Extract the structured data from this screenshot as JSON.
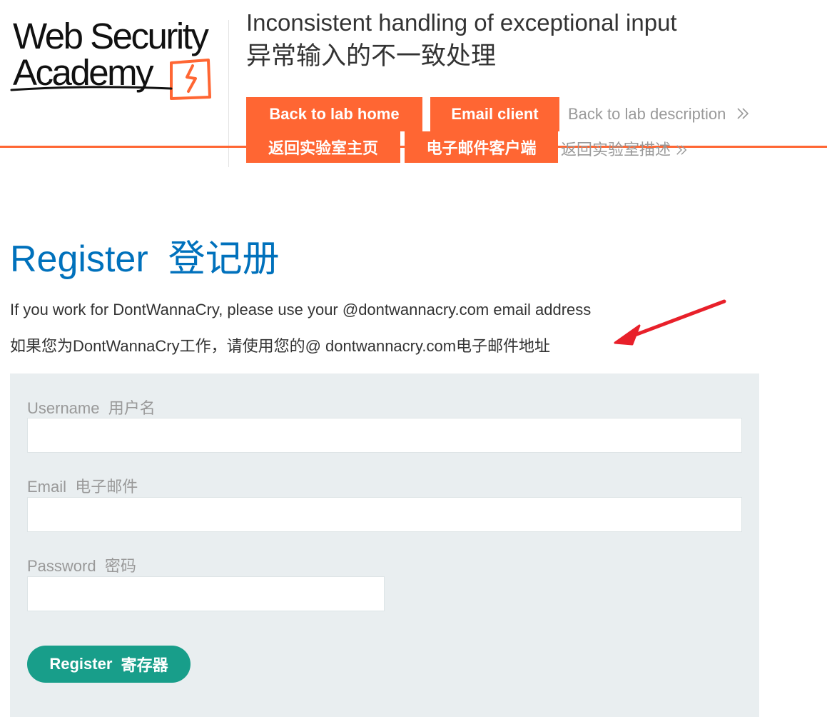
{
  "logo": {
    "line1": "Web Security",
    "line2": "Academy",
    "colors": {
      "text": "#111111",
      "accent": "#ff6633"
    }
  },
  "lab": {
    "title": "Inconsistent handling of exceptional input",
    "title_cn": "异常输入的不一致处理"
  },
  "nav": {
    "back_home": "Back to lab home",
    "back_home_cn": "返回实验室主页",
    "email_client": "Email client",
    "email_client_cn": "电子邮件客户端",
    "back_desc": "Back to lab description",
    "back_desc_cn": "返回实验室描述",
    "chevron_icon": "double-chevron-right-icon"
  },
  "page": {
    "title": "Register",
    "title_cn": "登记册",
    "intro": "If you work for DontWannaCry, please use your @dontwannacry.com email address",
    "intro_cn": "如果您为DontWannaCry工作，请使用您的@ dontwannacry.com电子邮件地址"
  },
  "form": {
    "username_label": "Username",
    "username_label_cn": "用户名",
    "username_value": "",
    "email_label": "Email",
    "email_label_cn": "电子邮件",
    "email_value": "",
    "password_label": "Password",
    "password_label_cn": "密码",
    "password_value": "",
    "submit": "Register",
    "submit_cn": "寄存器"
  },
  "annotation": {
    "icon": "red-arrow-icon",
    "color": "#e8202a"
  },
  "colors": {
    "accent": "#ff6633",
    "title_blue": "#0071bc",
    "button_green": "#189e8a",
    "panel_bg": "#e9eef0",
    "muted": "#999999"
  }
}
